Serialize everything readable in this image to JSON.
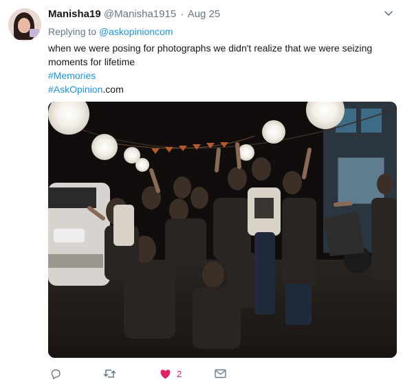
{
  "tweet": {
    "display_name": "Manisha19",
    "handle": "@Manisha1915",
    "separator": "·",
    "date": "Aug 25",
    "reply_prefix": "Replying to",
    "reply_mention": "@askopinioncom",
    "text_line_1": "when we were posing for photographs we didn't realize that we were seizing",
    "text_line_2": "moments for lifetime",
    "hashtag_1": "#Memories",
    "hashtag_2": "#AskOpinion",
    "hashtag_2_suffix": ".com",
    "photo_alt": "Group photo of friends posing at night under string lights"
  },
  "actions": {
    "reply_icon": "reply-icon",
    "retweet_icon": "retweet-icon",
    "like_icon": "heart-filled-icon",
    "like_count": "2",
    "message_icon": "envelope-icon"
  },
  "colors": {
    "link": "#1b95e0",
    "muted": "#657786",
    "like": "#e0245e",
    "text": "#14171a"
  }
}
